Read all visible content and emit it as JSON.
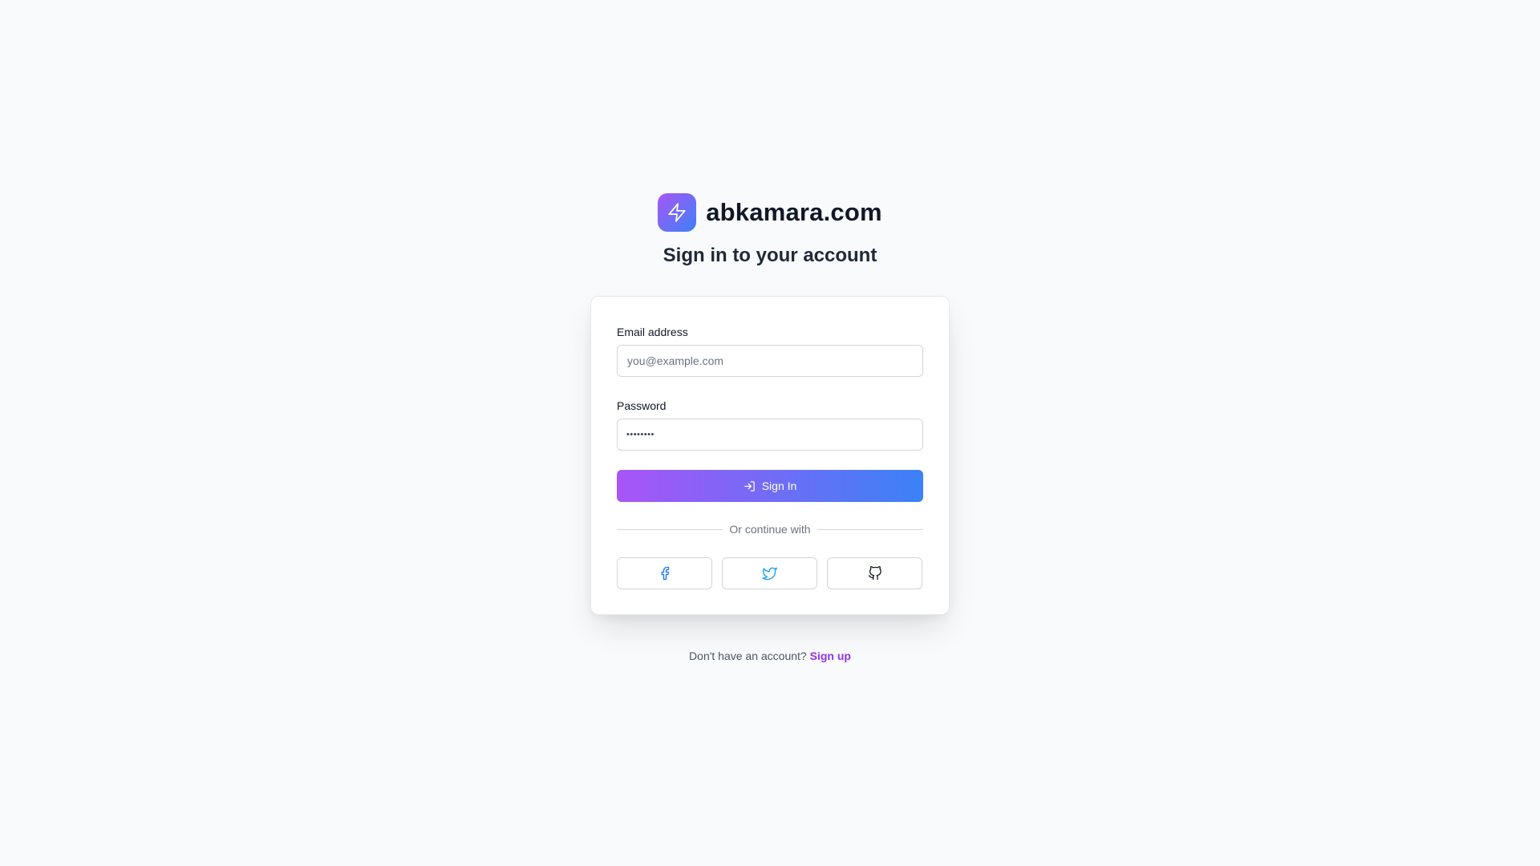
{
  "brand": {
    "name": "abkamara.com",
    "logo_icon": "lightning-bolt-icon"
  },
  "subtitle": "Sign in to your account",
  "form": {
    "email": {
      "label": "Email address",
      "value": "",
      "placeholder": "you@example.com"
    },
    "password": {
      "label": "Password",
      "value": "••••••••"
    },
    "submit": {
      "label": "Sign In",
      "icon": "log-in-icon"
    },
    "divider_text": "Or continue with",
    "social": [
      {
        "name": "facebook",
        "icon": "facebook-icon",
        "color": "#1877f2"
      },
      {
        "name": "twitter",
        "icon": "twitter-icon",
        "color": "#1da1f2"
      },
      {
        "name": "github",
        "icon": "github-icon",
        "color": "#111827"
      }
    ]
  },
  "footer": {
    "prompt": "Don't have an account?",
    "link": "Sign up"
  },
  "colors": {
    "background": "#f9fafb",
    "accent_start": "#a855f7",
    "accent_end": "#3b82f6",
    "link": "#9333ea"
  }
}
